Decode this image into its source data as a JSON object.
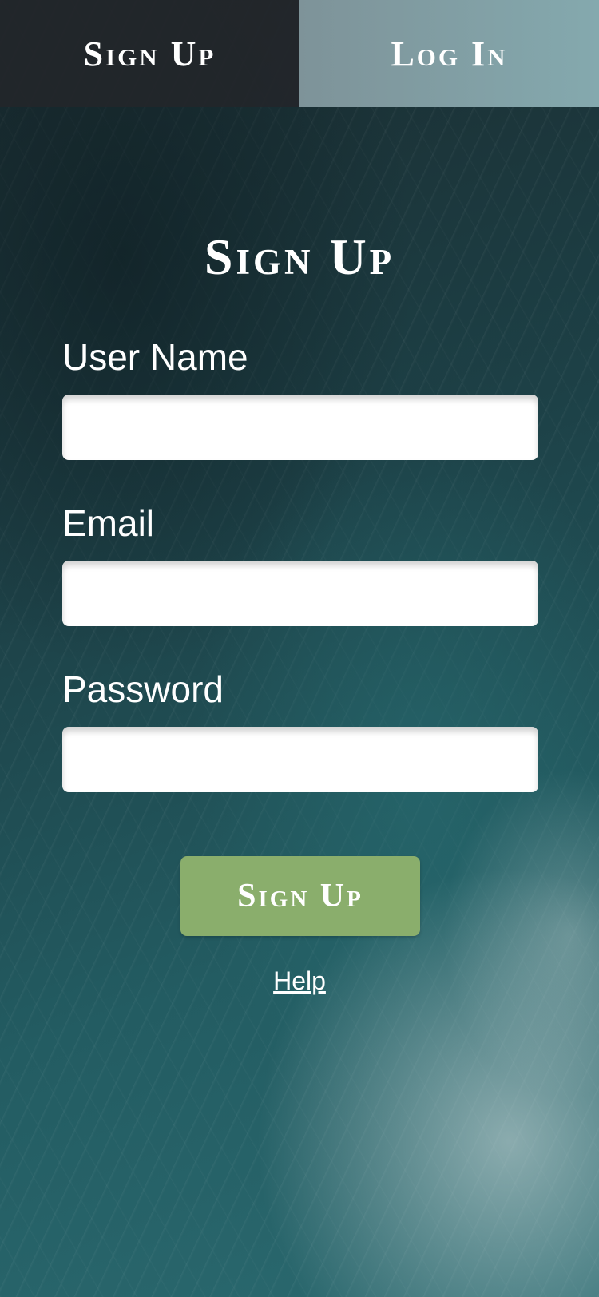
{
  "tabs": {
    "signup_label": "Sign Up",
    "login_label": "Log In"
  },
  "form": {
    "title": "Sign Up",
    "fields": [
      {
        "label": "User Name",
        "value": "",
        "placeholder": ""
      },
      {
        "label": "Email",
        "value": "",
        "placeholder": ""
      },
      {
        "label": "Password",
        "value": "",
        "placeholder": ""
      }
    ],
    "submit_label": "Sign Up",
    "help_label": "Help"
  },
  "colors": {
    "active_tab_bg": "#23262a",
    "inactive_tab_bg": "#84a9ae",
    "submit_button": "#8aae6c",
    "text": "#ffffff"
  }
}
